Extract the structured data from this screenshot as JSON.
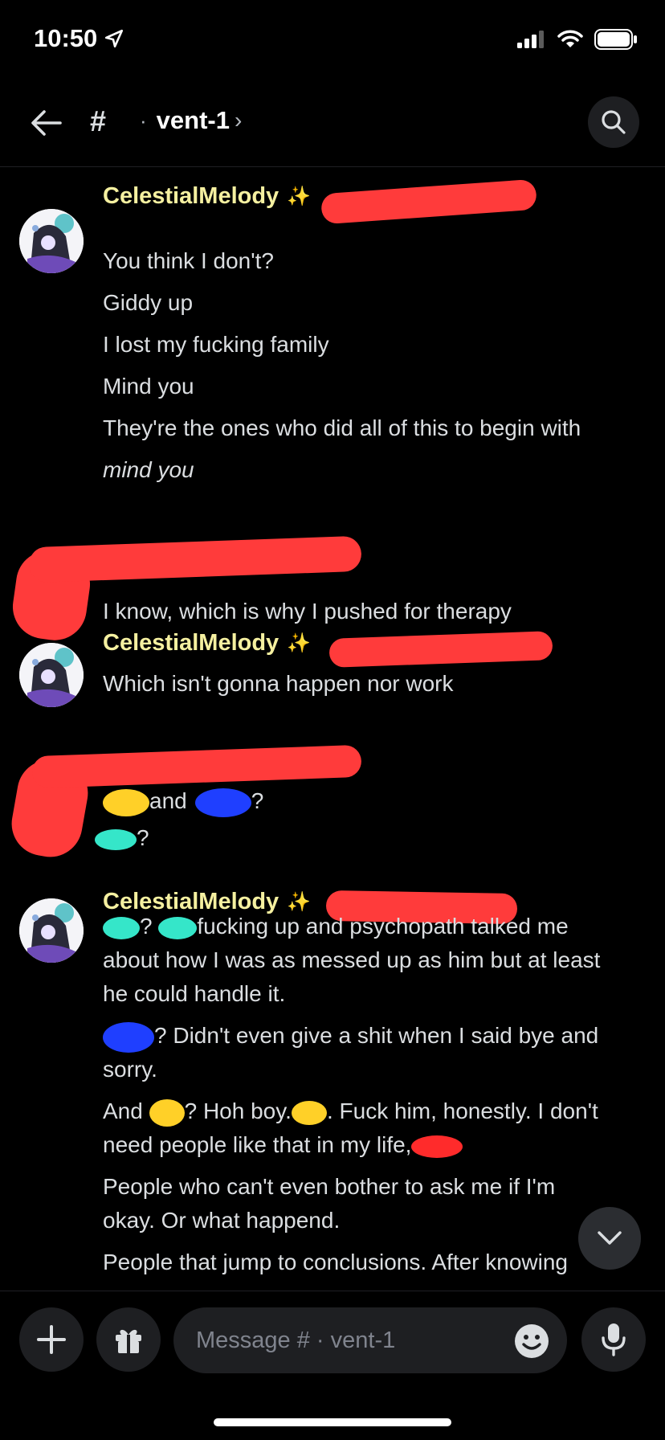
{
  "status_bar": {
    "time": "10:50"
  },
  "header": {
    "channel_name": "vent-1",
    "channel_dot": "·"
  },
  "messages": {
    "group1": {
      "username": "CelestialMelody",
      "badge": "✨",
      "lines": [
        "You think I don't?",
        "Giddy up",
        "I lost my fucking family",
        "Mind you",
        "They're the ones who did all of this to begin with",
        "mind you"
      ]
    },
    "group2": {
      "lines": [
        "I know, which is why I pushed for therapy"
      ]
    },
    "group3": {
      "username": "CelestialMelody",
      "badge": "✨",
      "lines": [
        "Which isn't gonna happen nor work"
      ]
    },
    "group4": {
      "line1_mid": "and",
      "line1_end": "?",
      "line2_end": "?"
    },
    "group5": {
      "username": "CelestialMelody",
      "badge": "✨",
      "l1_q": "?",
      "l1_rest": "fucking up and psychopath talked me",
      "l2": "about how I was as messed up as him but at least",
      "l3": "he could handle it.",
      "l4_rest": "? Didn't even give a shit when I said bye and",
      "l5": "sorry.",
      "l6_a": "And",
      "l6_b": "? Hoh boy.",
      "l6_c": ". Fuck him, honestly. I don't",
      "l7": "need people like that in my life,",
      "l8": "People who can't even bother to ask me if I'm",
      "l9": "okay. Or what happend.",
      "l10": "People that jump to conclusions. After knowing"
    }
  },
  "composer": {
    "placeholder": "Message # · vent-1"
  },
  "colors": {
    "background": "#000000",
    "username": "#f5f0a0",
    "redaction": "#ff3b3b"
  }
}
